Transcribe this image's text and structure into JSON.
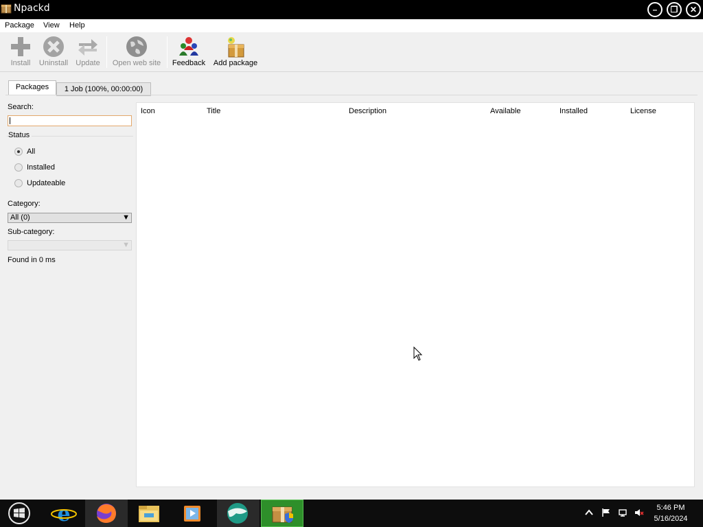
{
  "window": {
    "title": "Npackd",
    "icon": "package-icon",
    "controls": [
      "minimize-icon",
      "restore-icon",
      "close-icon"
    ]
  },
  "menu": [
    "Package",
    "View",
    "Help"
  ],
  "toolbar": {
    "install": "Install",
    "uninstall": "Uninstall",
    "update": "Update",
    "open_web_site": "Open web site",
    "feedback": "Feedback",
    "add_package": "Add package"
  },
  "tabs": {
    "packages": "Packages",
    "jobs": "1 Job (100%, 00:00:00)"
  },
  "filter": {
    "search_label": "Search:",
    "search_value": "",
    "status_label": "Status",
    "status_options": [
      "All",
      "Installed",
      "Updateable"
    ],
    "status_selected": "All",
    "category_label": "Category:",
    "category_value": "All (0)",
    "subcategory_label": "Sub-category:",
    "subcategory_value": "",
    "found_text": "Found in 0 ms"
  },
  "table": {
    "columns": [
      "Icon",
      "Title",
      "Description",
      "Available",
      "Installed",
      "License"
    ],
    "rows": []
  },
  "taskbar": {
    "items": [
      "windows-start-icon",
      "internet-explorer-icon",
      "firefox-icon",
      "file-explorer-icon",
      "media-player-icon",
      "browser-globe-icon",
      "npackd-package-icon"
    ],
    "tray": {
      "time": "5:46 PM",
      "date": "5/16/2024",
      "icons": [
        "chevron-up-icon",
        "flag-icon",
        "network-icon",
        "volume-muted-icon"
      ]
    }
  },
  "colors": {
    "titlebar": "#000000",
    "window_bg": "#f0f0f0",
    "taskbar": "#0d0d0d",
    "active_task": "#2e8f2a",
    "search_border": "#e3a86b"
  }
}
